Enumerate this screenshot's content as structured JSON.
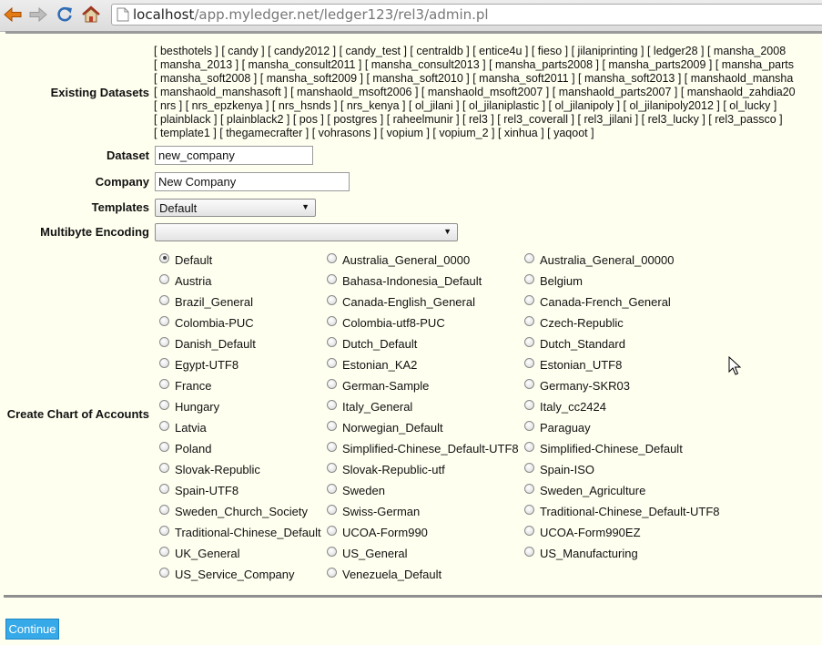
{
  "browser": {
    "url_host": "localhost",
    "url_path": "/app.myledger.net/ledger123/rel3/admin.pl"
  },
  "form": {
    "existing_datasets_label": "Existing Datasets",
    "datasets_lines": [
      "[ besthotels ] [ candy ] [ candy2012 ] [ candy_test ] [ centraldb ] [ entice4u ] [ fieso ] [ jilaniprinting ] [ ledger28 ] [ mansha_2008",
      "[ mansha_2013 ] [ mansha_consult2011 ] [ mansha_consult2013 ] [ mansha_parts2008 ] [ mansha_parts2009 ] [ mansha_parts",
      "[ mansha_soft2008 ] [ mansha_soft2009 ] [ mansha_soft2010 ] [ mansha_soft2011 ] [ mansha_soft2013 ] [ manshaold_mansha",
      "[ manshaold_manshasoft ] [ manshaold_msoft2006 ] [ manshaold_msoft2007 ] [ manshaold_parts2007 ] [ manshaold_zahdia20",
      "[ nrs ] [ nrs_epzkenya ] [ nrs_hsnds ] [ nrs_kenya ] [ ol_jilani ] [ ol_jilaniplastic ] [ ol_jilanipoly ] [ ol_jilanipoly2012 ] [ ol_lucky ]",
      "[ plainblack ] [ plainblack2 ] [ pos ] [ postgres ] [ raheelmunir ] [ rel3 ] [ rel3_coverall ] [ rel3_jilani ] [ rel3_lucky ] [ rel3_passco ]",
      "[ template1 ] [ thegamecrafter ] [ vohrasons ] [ vopium ] [ vopium_2 ] [ xinhua ] [ yaqoot ]"
    ],
    "dataset_label": "Dataset",
    "dataset_value": "new_company",
    "company_label": "Company",
    "company_value": "New Company",
    "templates_label": "Templates",
    "templates_value": "Default",
    "multibyte_label": "Multibyte Encoding",
    "multibyte_value": "",
    "chart_label": "Create Chart of Accounts",
    "chart_options": [
      [
        "Default",
        "Australia_General_0000",
        "Australia_General_00000"
      ],
      [
        "Austria",
        "Bahasa-Indonesia_Default",
        "Belgium"
      ],
      [
        "Brazil_General",
        "Canada-English_General",
        "Canada-French_General"
      ],
      [
        "Colombia-PUC",
        "Colombia-utf8-PUC",
        "Czech-Republic"
      ],
      [
        "Danish_Default",
        "Dutch_Default",
        "Dutch_Standard"
      ],
      [
        "Egypt-UTF8",
        "Estonian_KA2",
        "Estonian_UTF8"
      ],
      [
        "France",
        "German-Sample",
        "Germany-SKR03"
      ],
      [
        "Hungary",
        "Italy_General",
        "Italy_cc2424"
      ],
      [
        "Latvia",
        "Norwegian_Default",
        "Paraguay"
      ],
      [
        "Poland",
        "Simplified-Chinese_Default-UTF8",
        "Simplified-Chinese_Default"
      ],
      [
        "Slovak-Republic",
        "Slovak-Republic-utf",
        "Spain-ISO"
      ],
      [
        "Spain-UTF8",
        "Sweden",
        "Sweden_Agriculture"
      ],
      [
        "Sweden_Church_Society",
        "Swiss-German",
        "Traditional-Chinese_Default-UTF8"
      ],
      [
        "Traditional-Chinese_Default",
        "UCOA-Form990",
        "UCOA-Form990EZ"
      ],
      [
        "UK_General",
        "US_General",
        "US_Manufacturing"
      ],
      [
        "US_Service_Company",
        "Venezuela_Default",
        ""
      ]
    ],
    "selected_chart": "Default",
    "continue_label": "Continue"
  }
}
